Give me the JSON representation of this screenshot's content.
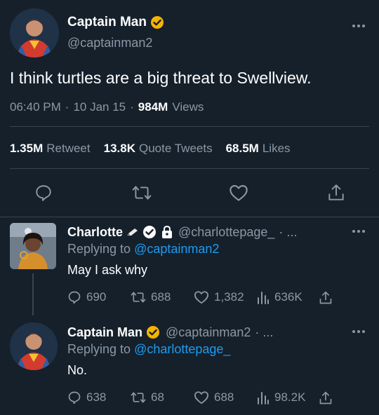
{
  "main": {
    "display_name": "Captain Man",
    "handle": "@captainman2",
    "text": "I think turtles are a big threat to Swellview.",
    "time": "06:40 PM",
    "date": "10 Jan 15",
    "sep": "·",
    "views_count": "984M",
    "views_label": "Views",
    "stats": {
      "retweets_count": "1.35M",
      "retweets_label": "Retweet",
      "quotes_count": "13.8K",
      "quotes_label": "Quote Tweets",
      "likes_count": "68.5M",
      "likes_label": "Likes"
    }
  },
  "reply1": {
    "display_name": "Charlotte",
    "handle": "@charlottepage_",
    "handle_suffix": "· ...",
    "replying_prefix": "Replying to",
    "replying_to": "@captainman2",
    "text": "May I ask why",
    "replies": "690",
    "retweets": "688",
    "likes": "1,382",
    "views": "636K"
  },
  "reply2": {
    "display_name": "Captain Man",
    "handle": "@captainman2",
    "handle_suffix": "· ...",
    "replying_prefix": "Replying to",
    "replying_to": "@charlottepage_",
    "text": "No.",
    "replies": "638",
    "retweets": "68",
    "likes": "688",
    "views": "98.2K"
  },
  "colors": {
    "background": "#15202b",
    "verified": "#f4b400",
    "link": "#1d9bf0",
    "muted": "#8b98a5"
  }
}
